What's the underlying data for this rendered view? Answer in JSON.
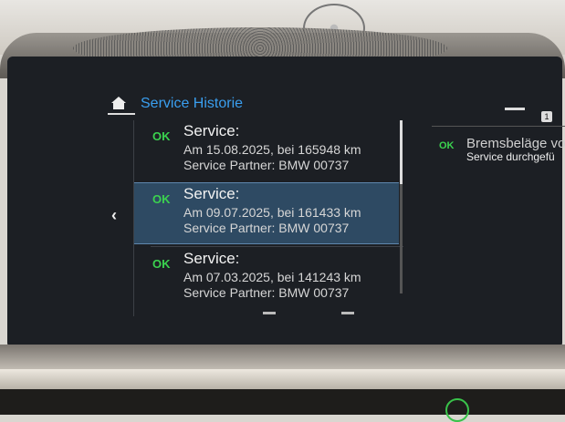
{
  "header": {
    "title": "Service Historie",
    "home_icon": "home-icon",
    "back_icon": "chevron-left-icon"
  },
  "entries": [
    {
      "status": "OK",
      "title": "Service:",
      "date_line": "Am 15.08.2025, bei 165948 km",
      "partner_line": "Service Partner: BMW 00737"
    },
    {
      "status": "OK",
      "title": "Service:",
      "date_line": "Am 09.07.2025, bei 161433 km",
      "partner_line": "Service Partner: BMW 00737"
    },
    {
      "status": "OK",
      "title": "Service:",
      "date_line": "Am 07.03.2025, bei 141243 km",
      "partner_line": "Service Partner: BMW 00737"
    }
  ],
  "selected_index": 1,
  "detail": {
    "status": "OK",
    "line1": "Bremsbeläge vo",
    "line2": "Service durchgefü",
    "page_badge": "1"
  },
  "colors": {
    "accent": "#3a9ff0",
    "ok": "#3bd24f",
    "selection": "#2e4a63"
  }
}
